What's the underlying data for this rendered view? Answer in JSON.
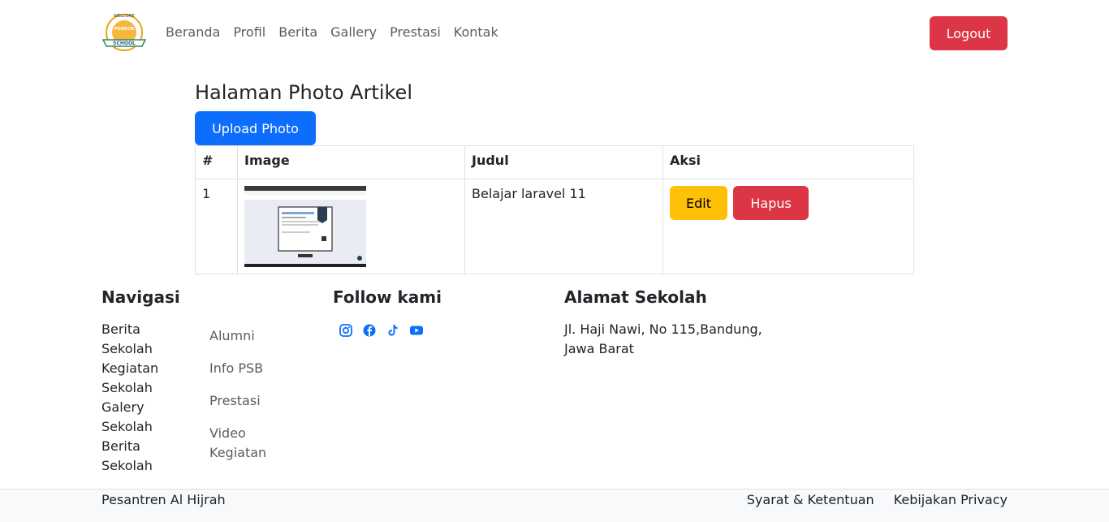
{
  "navbar": {
    "logo_text_top": "WELCOME",
    "logo_text_mid": "PONDOK",
    "logo_text_banner": "SCHOOL",
    "links": [
      "Beranda",
      "Profil",
      "Berita",
      "Gallery",
      "Prestasi",
      "Kontak"
    ],
    "logout_label": "Logout"
  },
  "main": {
    "title": "Halaman Photo Artikel",
    "upload_label": "Upload Photo",
    "table": {
      "headers": [
        "#",
        "Image",
        "Judul",
        "Aksi"
      ],
      "rows": [
        {
          "no": "1",
          "judul": "Belajar laravel 11",
          "edit_label": "Edit",
          "delete_label": "Hapus"
        }
      ]
    }
  },
  "footer": {
    "nav_title": "Navigasi",
    "nav_col1": [
      "Berita",
      "Sekolah",
      "Kegiatan",
      "Sekolah",
      "Galery",
      "Sekolah",
      "Berita",
      "Sekolah"
    ],
    "nav_col2": [
      "Alumni",
      "Info PSB",
      "Prestasi",
      "Video Kegiatan"
    ],
    "follow_title": "Follow kami",
    "social_icons": [
      "instagram-icon",
      "facebook-icon",
      "tiktok-icon",
      "youtube-icon"
    ],
    "address_title": "Alamat Sekolah",
    "address_line1": "Jl. Haji Nawi, No 115,Bandung,",
    "address_line2": "Jawa Barat",
    "copyright": "Pesantren Al Hijrah",
    "bottom_links": [
      "Syarat & Ketentuan",
      "Kebijakan Privacy"
    ]
  },
  "colors": {
    "primary": "#0d6efd",
    "danger": "#dc3545",
    "warning": "#ffc107",
    "social_blue": "#0d6efd"
  }
}
